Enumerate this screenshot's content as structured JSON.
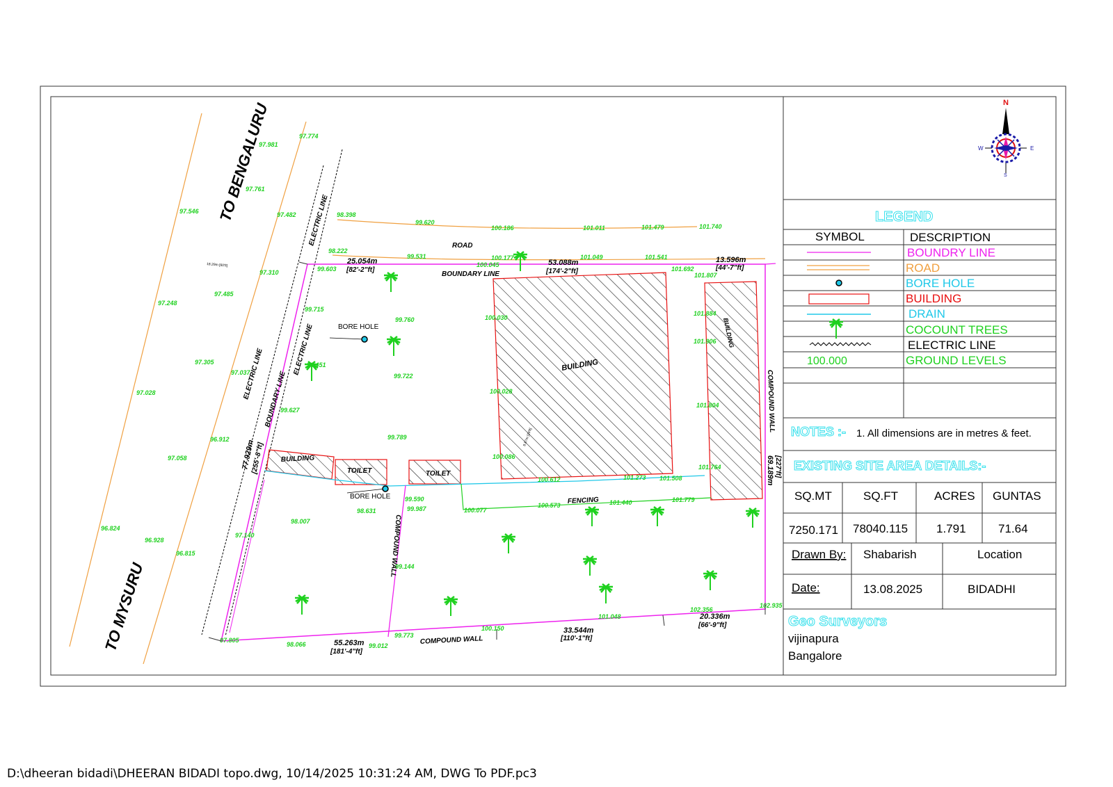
{
  "roads": {
    "to_bengaluru": "TO BENGALURU",
    "to_mysuru": "TO MYSURU",
    "road": "ROAD"
  },
  "lines": {
    "electric_line": "ELECTRIC LINE",
    "boundary_line": "BOUNDARY LINE",
    "compound_wall": "COMPOUND WALL",
    "fencing": "FENCING"
  },
  "structures": {
    "building": "BUILDING",
    "toilet": "TOILET",
    "bore_hole": "BORE HOLE",
    "road_width": "18.29m [60'ft]",
    "building_dim": "8.87m [29'ft]"
  },
  "dimensions": [
    {
      "m": "25.054m",
      "ft": "[82'-2\"ft]"
    },
    {
      "m": "53.088m",
      "ft": "[174'-2\"ft]"
    },
    {
      "m": "13.596m",
      "ft": "[44'-7\"ft]"
    },
    {
      "m": "77.929m",
      "ft": "[255'-8\"ft]"
    },
    {
      "m": "69.189m",
      "ft": "[227'ft]"
    },
    {
      "m": "55.263m",
      "ft": "[181'-4\"ft]"
    },
    {
      "m": "33.544m",
      "ft": "[110'-1\"ft]"
    },
    {
      "m": "20.336m",
      "ft": "[66'-9\"ft]"
    }
  ],
  "levels": [
    "97.981",
    "97.774",
    "97.761",
    "97.546",
    "97.482",
    "98.398",
    "99.620",
    "100.186",
    "101.011",
    "101.479",
    "101.740",
    "98.222",
    "99.531",
    "100.177",
    "101.049",
    "101.541",
    "99.603",
    "100.045",
    "101.692",
    "101.807",
    "97.310",
    "97.485",
    "97.248",
    "99.715",
    "99.760",
    "100.030",
    "101.884",
    "101.906",
    "97.305",
    "97.037",
    "99.451",
    "99.722",
    "100.028",
    "101.804",
    "97.028",
    "99.627",
    "96.912",
    "97.058",
    "99.789",
    "100.086",
    "101.764",
    "100.612",
    "101.273",
    "101.508",
    "99.590",
    "99.987",
    "100.077",
    "100.573",
    "101.440",
    "101.779",
    "98.007",
    "98.631",
    "97.140",
    "96.824",
    "96.928",
    "96.815",
    "99.144",
    "101.048",
    "102.356",
    "102.935",
    "97.805",
    "98.066",
    "99.012",
    "99.773",
    "100.150"
  ],
  "compass": {
    "n": "N",
    "s": "S",
    "e": "E",
    "w": "W"
  },
  "legend": {
    "title": "LEGEND",
    "col_symbol": "SYMBOL",
    "col_description": "DESCRIPTION",
    "items": [
      {
        "label": "BOUNDRY LINE",
        "color": "#ee22ee"
      },
      {
        "label": "ROAD",
        "color": "#f0a040"
      },
      {
        "label": "BORE HOLE",
        "color": "#20c8e8"
      },
      {
        "label": "BUILDING",
        "color": "#e81010"
      },
      {
        "label": "DRAIN",
        "color": "#20c8e8"
      },
      {
        "label": "COCOUNT TREES",
        "color": "#1fd11f"
      },
      {
        "label": "ELECTRIC LINE",
        "color": "#000000"
      },
      {
        "label": "GROUND LEVELS",
        "color": "#1fd11f"
      }
    ],
    "ground_level_sample": "100.000"
  },
  "notes": {
    "heading": "NOTES :-",
    "text": "1. All dimensions are in metres & feet."
  },
  "area": {
    "heading": "EXISTING SITE  AREA DETAILS:-",
    "headers": [
      "SQ.MT",
      "SQ.FT",
      "ACRES",
      "GUNTAS"
    ],
    "values": [
      "7250.171",
      "78040.115",
      "1.791",
      "71.64"
    ]
  },
  "info": {
    "drawn_by_label": "Drawn By:",
    "drawn_by": "Shabarish",
    "location_label": "Location",
    "date_label": "Date:",
    "date": "13.08.2025",
    "location": "BIDADHI"
  },
  "company": {
    "name": "Geo Surveyors",
    "line1": "vijinapura",
    "line2": "Bangalore"
  },
  "footer": "D:\\dheeran bidadi\\DHEERAN BIDADI topo.dwg, 10/14/2025 10:31:24 AM, DWG To PDF.pc3",
  "colors": {
    "boundary": "#ee22ee",
    "road": "#f0a040",
    "building": "#e81010",
    "drain": "#20c8e8",
    "tree": "#1fd11f",
    "accent": "#35e0ec"
  }
}
